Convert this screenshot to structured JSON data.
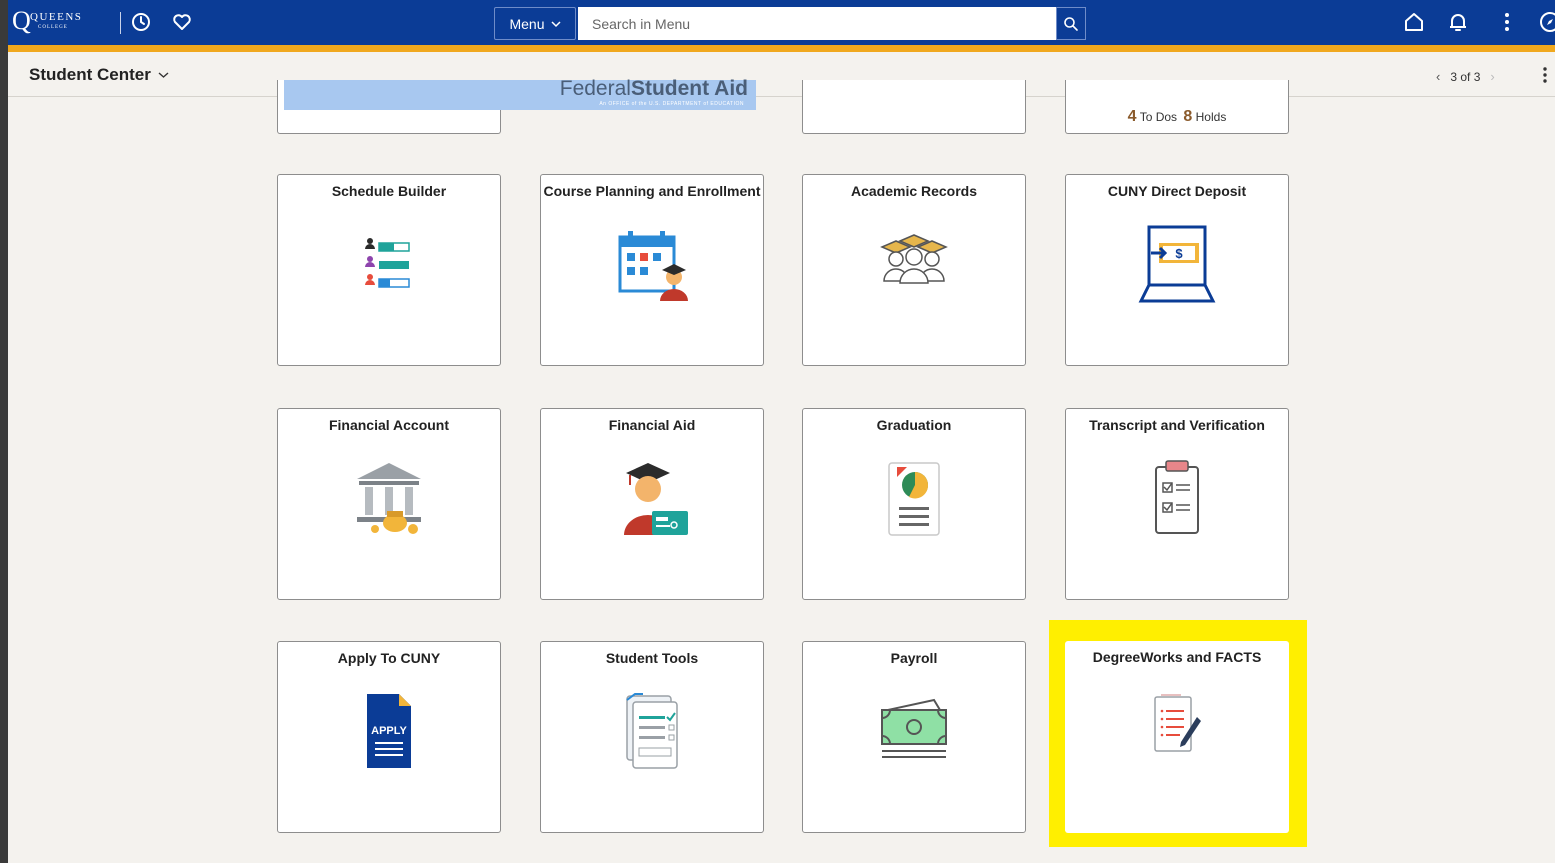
{
  "topbar": {
    "logo_big": "Q",
    "logo_word": "QUEENS",
    "logo_sub": "COLLEGE",
    "menu_label": "Menu",
    "search_placeholder": "Search in Menu"
  },
  "subbar": {
    "title": "Student Center",
    "pager": "3 of 3"
  },
  "top_partial": {
    "fsa_text": "Federal",
    "fsa_text_bold": "Student Aid",
    "fsa_tagline": "An OFFICE of the U.S. DEPARTMENT of EDUCATION",
    "todos_count": "4",
    "todos_label": "To Dos",
    "holds_count": "8",
    "holds_label": "Holds"
  },
  "tiles": [
    {
      "title": "Schedule Builder",
      "icon": "schedule-list-icon"
    },
    {
      "title": "Course Planning and Enrollment",
      "icon": "calendar-student-icon"
    },
    {
      "title": "Academic Records",
      "icon": "graduates-icon"
    },
    {
      "title": "CUNY Direct Deposit",
      "icon": "laptop-deposit-icon"
    },
    {
      "title": "Financial Account",
      "icon": "bank-money-icon"
    },
    {
      "title": "Financial Aid",
      "icon": "student-card-icon"
    },
    {
      "title": "Graduation",
      "icon": "report-chart-icon"
    },
    {
      "title": "Transcript and Verification",
      "icon": "clipboard-checklist-icon"
    },
    {
      "title": "Apply To CUNY",
      "icon": "apply-document-icon",
      "icon_text": "APPLY"
    },
    {
      "title": "Student Tools",
      "icon": "documents-checklist-icon"
    },
    {
      "title": "Payroll",
      "icon": "cash-bill-icon"
    },
    {
      "title": "DegreeWorks and FACTS",
      "icon": "document-pen-icon"
    }
  ],
  "colors": {
    "navbar": "#0b3c96",
    "navbar_accent": "#f0a81e",
    "highlight": "#ffef00",
    "count_brown": "#8a5a2b"
  }
}
